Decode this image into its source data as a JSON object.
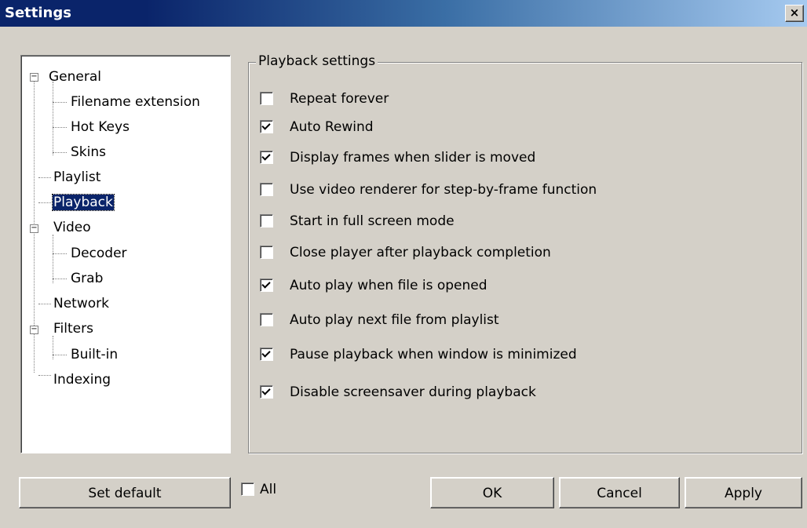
{
  "window": {
    "title": "Settings",
    "close_glyph": "×"
  },
  "tree": {
    "items": [
      {
        "label": "General",
        "expander": "−"
      },
      {
        "label": "Filename extension"
      },
      {
        "label": "Hot Keys"
      },
      {
        "label": "Skins"
      },
      {
        "label": "Playlist"
      },
      {
        "label": "Playback",
        "selected": true
      },
      {
        "label": "Video",
        "expander": "−"
      },
      {
        "label": "Decoder"
      },
      {
        "label": "Grab"
      },
      {
        "label": "Network"
      },
      {
        "label": "Filters",
        "expander": "−"
      },
      {
        "label": "Built-in"
      },
      {
        "label": "Indexing"
      }
    ]
  },
  "playback": {
    "legend": "Playback settings",
    "options": [
      {
        "label": "Repeat forever",
        "checked": false
      },
      {
        "label": "Auto Rewind",
        "checked": true
      },
      {
        "label": "Display frames when slider is moved",
        "checked": true
      },
      {
        "label": "Use video renderer for step-by-frame function",
        "checked": false
      },
      {
        "label": "Start in full screen mode",
        "checked": false
      },
      {
        "label": "Close player after playback completion",
        "checked": false
      },
      {
        "label": "Auto play when file is opened",
        "checked": true
      },
      {
        "label": "Auto play next file from playlist",
        "checked": false
      },
      {
        "label": "Pause playback when window is minimized",
        "checked": true
      },
      {
        "label": "Disable screensaver during playback",
        "checked": true
      }
    ]
  },
  "footer": {
    "set_default": "Set default",
    "all_label": "All",
    "all_checked": false,
    "ok": "OK",
    "cancel": "Cancel",
    "apply": "Apply"
  }
}
